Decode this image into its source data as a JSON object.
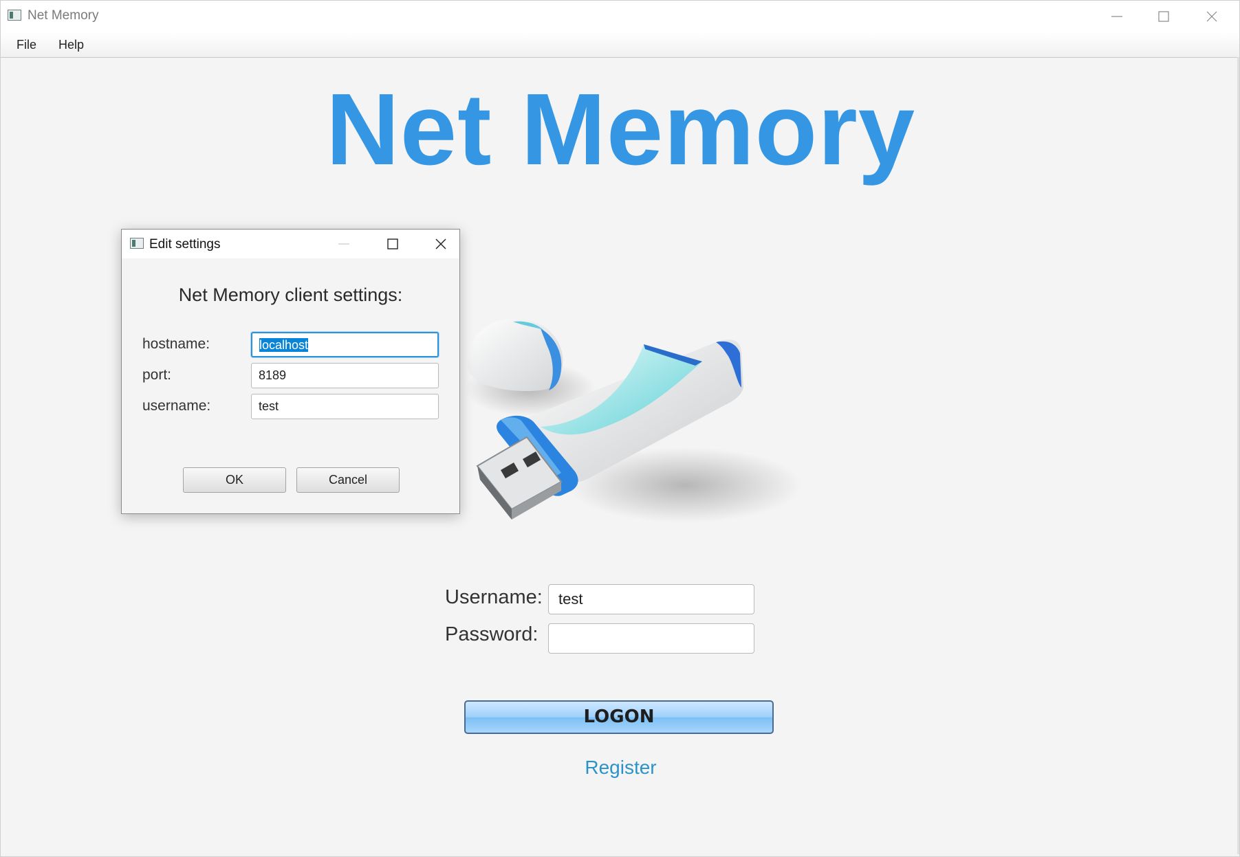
{
  "window": {
    "title": "Net Memory",
    "icon": "app-icon"
  },
  "menu": {
    "file": "File",
    "help": "Help"
  },
  "hero": {
    "title": "Net Memory",
    "image": "usb-flash-drive-icon"
  },
  "login": {
    "username_label": "Username:",
    "username_value": "test",
    "password_label": "Password:",
    "password_value": "",
    "logon_label": "LOGON",
    "register_label": "Register"
  },
  "dialog": {
    "title": "Edit settings",
    "heading": "Net Memory client settings:",
    "fields": [
      {
        "label": "hostname:",
        "value": "localhost"
      },
      {
        "label": "port:",
        "value": "8189"
      },
      {
        "label": "username:",
        "value": "test"
      }
    ],
    "ok_label": "OK",
    "cancel_label": "Cancel"
  },
  "colors": {
    "brand": "#3597e3",
    "link": "#2b93c8",
    "selection": "#0a84d6",
    "focus": "#2d93d6"
  }
}
